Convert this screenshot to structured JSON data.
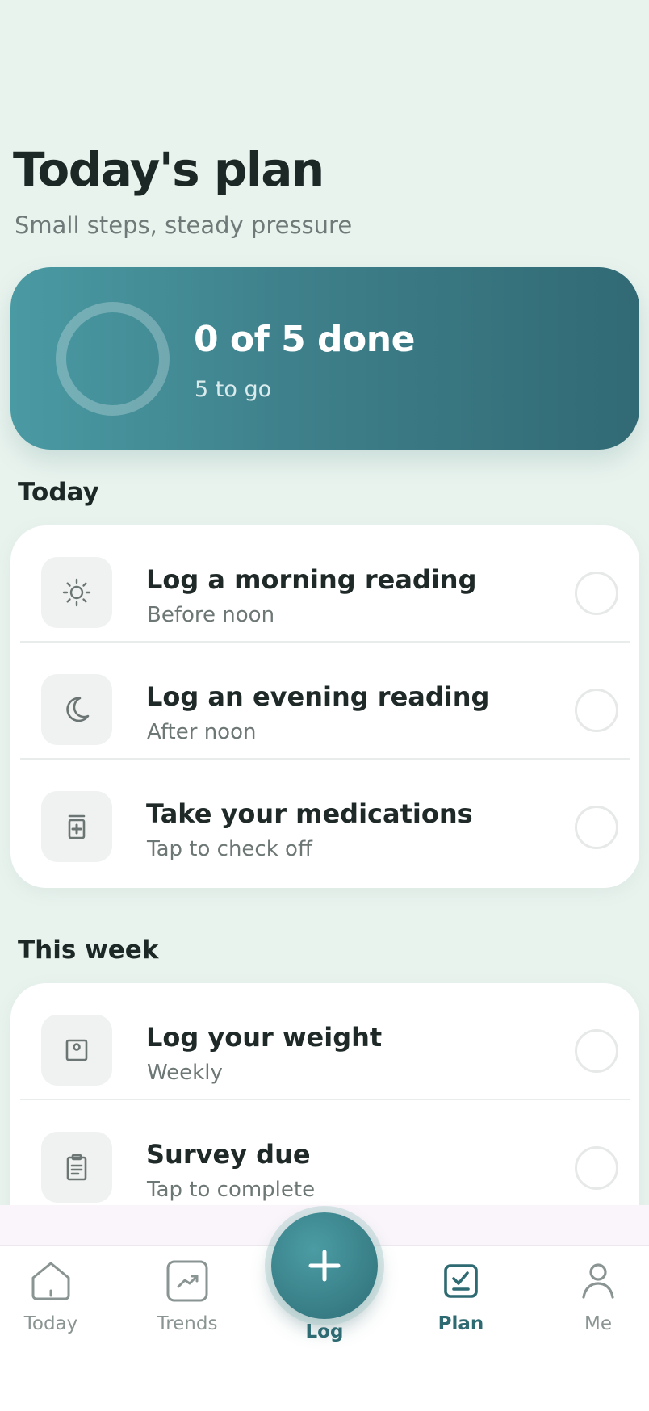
{
  "header": {
    "title": "Today's plan",
    "subtitle": "Small steps, steady pressure"
  },
  "progress": {
    "title": "0 of 5 done",
    "subtitle": "5 to go",
    "completed_fraction": 0
  },
  "sections": {
    "today": {
      "label": "Today",
      "items": [
        {
          "icon": "sun-icon",
          "title": "Log a morning reading",
          "subtitle": "Before noon"
        },
        {
          "icon": "moon-icon",
          "title": "Log an evening reading",
          "subtitle": "After noon"
        },
        {
          "icon": "medication-icon",
          "title": "Take your medications",
          "subtitle": "Tap to check off"
        }
      ]
    },
    "week": {
      "label": "This week",
      "items": [
        {
          "icon": "scale-icon",
          "title": "Log your weight",
          "subtitle": "Weekly"
        },
        {
          "icon": "clipboard-icon",
          "title": "Survey due",
          "subtitle": "Tap to complete"
        }
      ]
    }
  },
  "tabbar": {
    "today": "Today",
    "trends": "Trends",
    "log": "Log",
    "plan": "Plan",
    "me": "Me",
    "active": "plan"
  },
  "colors": {
    "accent": "#2e6a72",
    "background": "#e9f3ee",
    "card_gradient_start": "#4a9aa3",
    "card_gradient_end": "#316a74"
  }
}
